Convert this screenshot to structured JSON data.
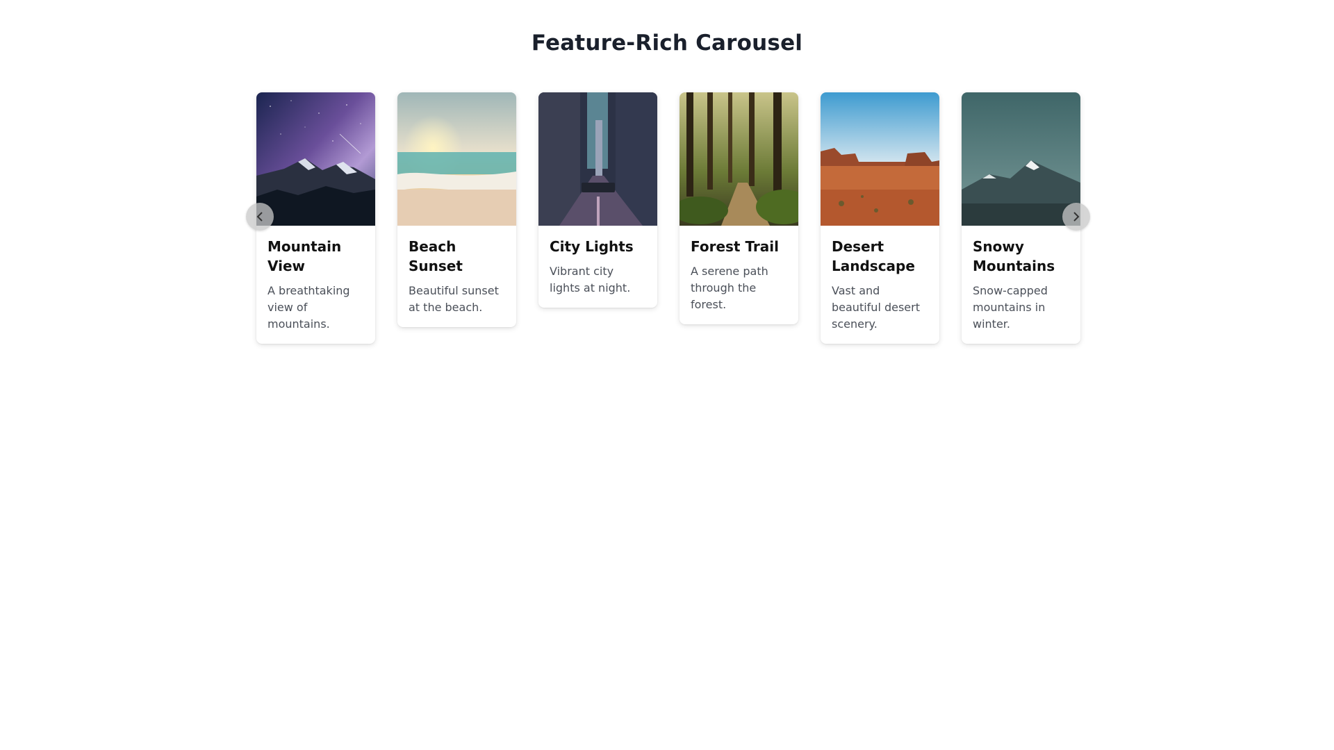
{
  "page": {
    "title": "Feature-Rich Carousel"
  },
  "carousel": {
    "cards": [
      {
        "title": "Mountain View",
        "description": "A breathtaking view of mountains.",
        "image": "mountain-night-image"
      },
      {
        "title": "Beach Sunset",
        "description": "Beautiful sunset at the beach.",
        "image": "beach-sunset-image"
      },
      {
        "title": "City Lights",
        "description": "Vibrant city lights at night.",
        "image": "city-street-image"
      },
      {
        "title": "Forest Trail",
        "description": "A serene path through the forest.",
        "image": "forest-trail-image"
      },
      {
        "title": "Desert Landscape",
        "description": "Vast and beautiful desert scenery.",
        "image": "desert-landscape-image"
      },
      {
        "title": "Snowy Mountains",
        "description": "Snow-capped mountains in winter.",
        "image": "snowy-mountain-image"
      }
    ],
    "prev_icon": "chevron-left-icon",
    "next_icon": "chevron-right-icon"
  },
  "colors": {
    "title": "#1a202c",
    "card_title": "#111111",
    "card_desc": "#4a4f58",
    "nav_bg": "#c8c8c8"
  }
}
